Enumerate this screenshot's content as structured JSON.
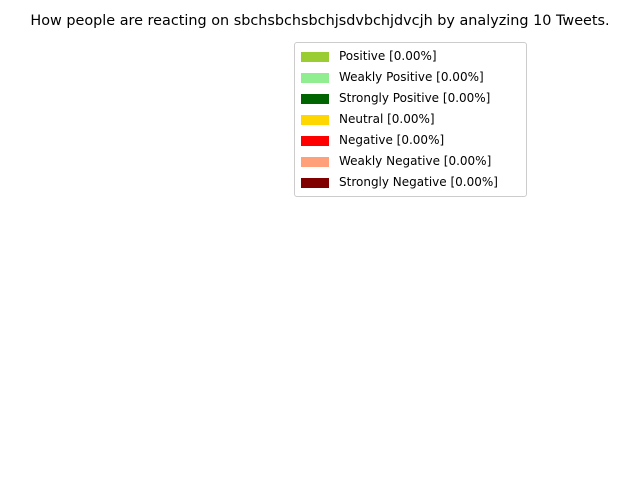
{
  "chart_data": {
    "type": "pie",
    "title": "How people are reacting on sbchsbchsbchjsdvbchjdvcjh by analyzing 10 Tweets.",
    "legend_placement": "upper-right",
    "categories": [
      "Positive",
      "Weakly Positive",
      "Strongly Positive",
      "Neutral",
      "Negative",
      "Weakly Negative",
      "Strongly Negative"
    ],
    "values": [
      0,
      0,
      0,
      0,
      0,
      0,
      0
    ],
    "legend": [
      {
        "label": "Positive [0.00%]",
        "color": "#9acd32"
      },
      {
        "label": "Weakly Positive [0.00%]",
        "color": "#90ee90"
      },
      {
        "label": "Strongly Positive [0.00%]",
        "color": "#006400"
      },
      {
        "label": "Neutral [0.00%]",
        "color": "#ffd700"
      },
      {
        "label": "Negative [0.00%]",
        "color": "#ff0000"
      },
      {
        "label": "Weakly Negative [0.00%]",
        "color": "#ffa07a"
      },
      {
        "label": "Strongly Negative [0.00%]",
        "color": "#800000"
      }
    ]
  }
}
